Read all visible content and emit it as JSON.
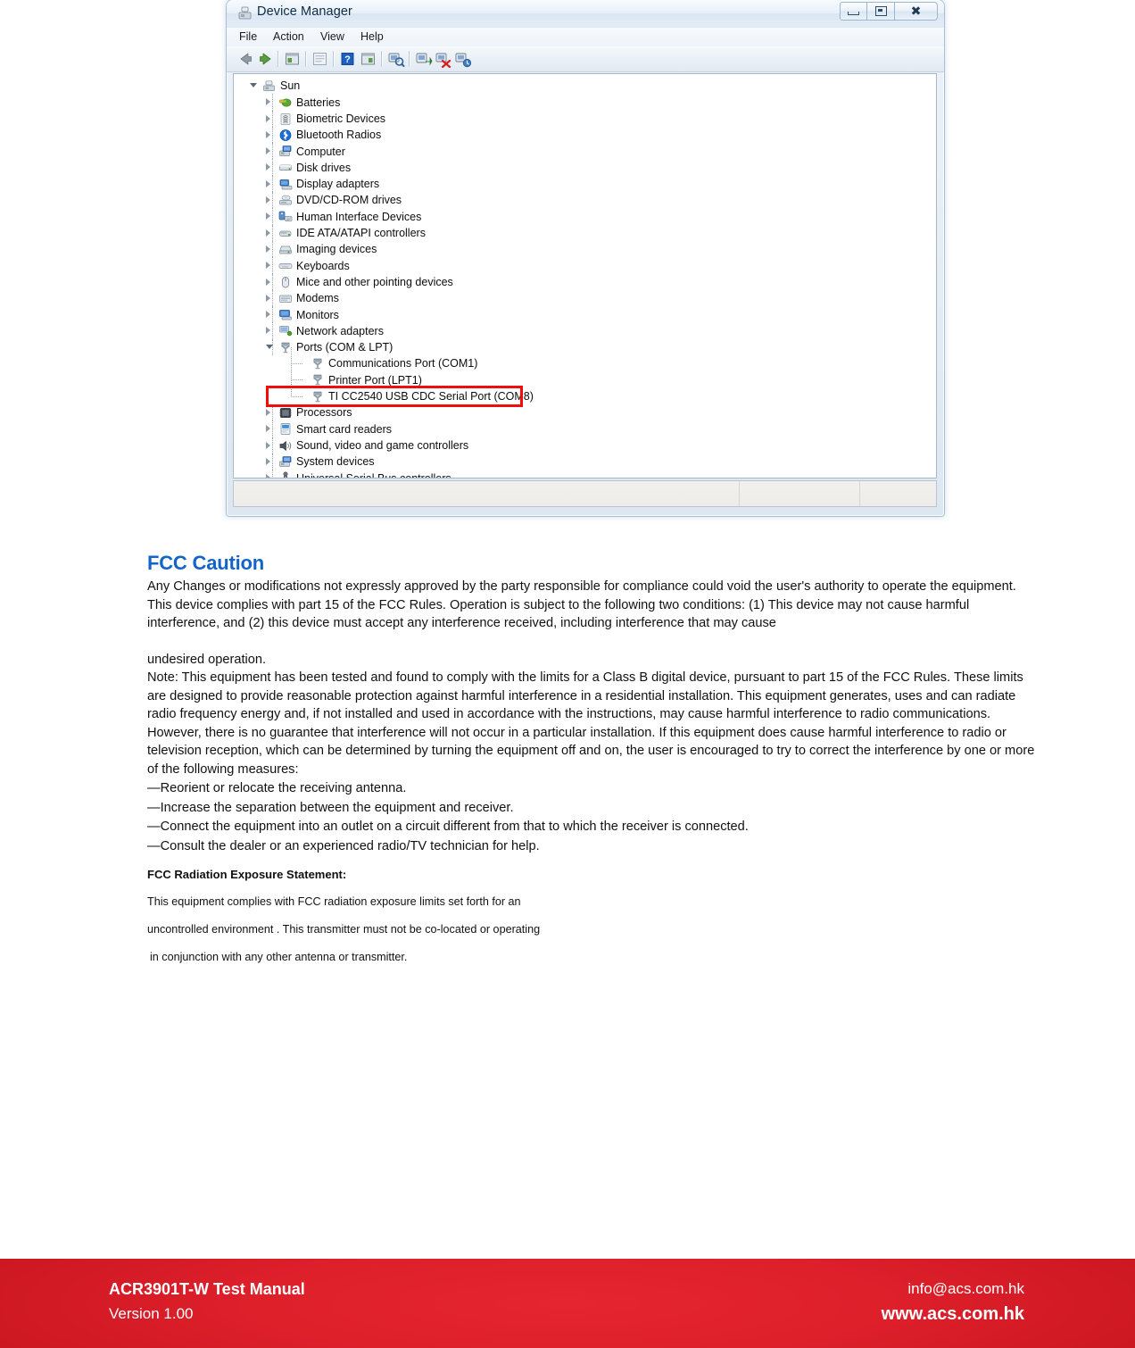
{
  "window": {
    "title": "Device Manager",
    "title_icon": "device-manager-icon",
    "controls": {
      "minimize": "Minimize",
      "maximize": "Restore",
      "close": "Close"
    },
    "menu": [
      {
        "label": "File"
      },
      {
        "label": "Action"
      },
      {
        "label": "View"
      },
      {
        "label": "Help"
      }
    ],
    "toolbar": [
      {
        "name": "back-arrow-icon",
        "title": "Back"
      },
      {
        "name": "forward-arrow-icon",
        "title": "Forward"
      },
      {
        "name": "show-hide-console-tree-icon",
        "title": "Show/Hide Console Tree"
      },
      {
        "name": "properties-icon",
        "title": "Properties"
      },
      {
        "name": "help-icon",
        "title": "Help"
      },
      {
        "name": "show-hide-action-pane-icon",
        "title": "Show/Hide Action Pane"
      },
      {
        "name": "scan-for-hardware-changes-icon",
        "title": "Scan for hardware changes"
      },
      {
        "name": "update-driver-icon",
        "title": "Update Driver Software"
      },
      {
        "name": "disable-device-icon",
        "title": "Disable"
      },
      {
        "name": "uninstall-device-icon",
        "title": "Uninstall"
      }
    ]
  },
  "tree": {
    "root": {
      "label": "Sun",
      "icon": "computer-icon",
      "expanded": true
    },
    "items": [
      {
        "label": "Batteries",
        "icon": "battery-icon",
        "expandable": true
      },
      {
        "label": "Biometric Devices",
        "icon": "fingerprint-icon",
        "expandable": true
      },
      {
        "label": "Bluetooth Radios",
        "icon": "bluetooth-icon",
        "expandable": true
      },
      {
        "label": "Computer",
        "icon": "computer-icon",
        "expandable": true
      },
      {
        "label": "Disk drives",
        "icon": "disk-drive-icon",
        "expandable": true
      },
      {
        "label": "Display adapters",
        "icon": "display-adapter-icon",
        "expandable": true
      },
      {
        "label": "DVD/CD-ROM drives",
        "icon": "optical-drive-icon",
        "expandable": true
      },
      {
        "label": "Human Interface Devices",
        "icon": "hid-icon",
        "expandable": true
      },
      {
        "label": "IDE ATA/ATAPI controllers",
        "icon": "ide-controller-icon",
        "expandable": true
      },
      {
        "label": "Imaging devices",
        "icon": "imaging-device-icon",
        "expandable": true
      },
      {
        "label": "Keyboards",
        "icon": "keyboard-icon",
        "expandable": true
      },
      {
        "label": "Mice and other pointing devices",
        "icon": "mouse-icon",
        "expandable": true
      },
      {
        "label": "Modems",
        "icon": "modem-icon",
        "expandable": true
      },
      {
        "label": "Monitors",
        "icon": "monitor-icon",
        "expandable": true
      },
      {
        "label": "Network adapters",
        "icon": "network-adapter-icon",
        "expandable": true
      },
      {
        "label": "Ports (COM & LPT)",
        "icon": "port-icon",
        "expandable": true,
        "expanded": true
      },
      {
        "label": "Processors",
        "icon": "processor-icon",
        "expandable": true
      },
      {
        "label": "Smart card readers",
        "icon": "smart-card-reader-icon",
        "expandable": true
      },
      {
        "label": "Sound, video and game controllers",
        "icon": "speaker-icon",
        "expandable": true
      },
      {
        "label": "System devices",
        "icon": "system-device-icon",
        "expandable": true
      },
      {
        "label": "Universal Serial Bus controllers",
        "icon": "usb-icon",
        "expandable": true
      }
    ],
    "ports_children": [
      {
        "label": "Communications Port (COM1)",
        "icon": "port-icon",
        "highlighted": false
      },
      {
        "label": "Printer Port (LPT1)",
        "icon": "port-icon",
        "highlighted": false
      },
      {
        "label": "TI CC2540 USB CDC Serial Port (COM8)",
        "icon": "port-icon",
        "highlighted": true
      }
    ],
    "highlight_color": "#f20d0d"
  },
  "fcc": {
    "heading": "FCC Caution",
    "heading_color": "#1464c8",
    "paragraphs": [
      "Any Changes or modifications not expressly approved by the party responsible for compliance could void the user's authority to operate the equipment.",
      "This device complies with part 15 of the FCC Rules. Operation is subject to the following two conditions: (1) This device may not cause harmful interference, and (2) this device must accept any interference received, including interference that may cause",
      "undesired operation.",
      "Note: This equipment has been tested and found to comply with the limits for a Class B digital device, pursuant to part 15 of the FCC Rules. These limits are designed to provide reasonable protection against harmful interference in a residential installation. This equipment generates, uses and can radiate radio frequency energy and, if not installed and used in accordance with the instructions, may cause harmful interference to radio communications. However, there is no guarantee that interference will not occur in a particular installation. If this equipment does cause harmful interference to radio or television reception, which can be determined by turning the equipment off and on, the user is encouraged to try to correct the interference by one or more of the following measures:"
    ],
    "measures": [
      "—Reorient or relocate the receiving antenna.",
      "—Increase the separation between the equipment and receiver.",
      "—Connect the equipment into an outlet on a circuit different from that to which the receiver is connected.",
      "—Consult the dealer or an experienced radio/TV technician for help."
    ],
    "radiation_heading": "FCC Radiation Exposure Statement:",
    "radiation_lines": [
      "This equipment complies with FCC radiation exposure limits set forth for an",
      "uncontrolled environment . This transmitter must not be co-located or operating",
      " in conjunction with any other antenna or transmitter."
    ]
  },
  "footer": {
    "manual_title": "ACR3901T-W Test Manual",
    "version": "Version 1.00",
    "email": "info@acs.com.hk",
    "website": "www.acs.com.hk",
    "background_color": "#de202b"
  }
}
